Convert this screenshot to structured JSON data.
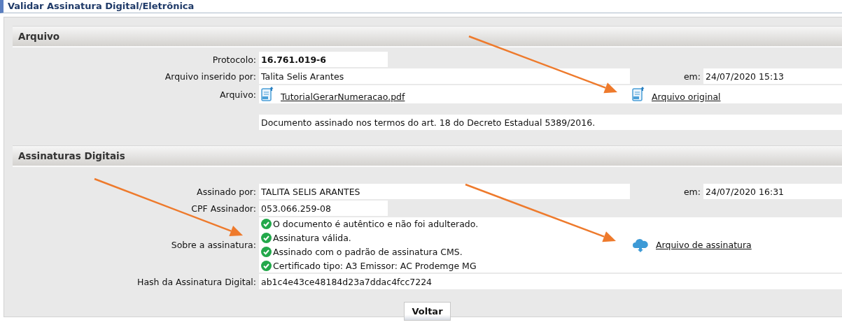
{
  "page_title": "Validar Assinatura Digital/Eletrônica",
  "sections": [
    {
      "title": "Arquivo",
      "rows": [
        {
          "kind": "protocol",
          "label": "Protocolo:",
          "value": "16.761.019-6"
        },
        {
          "kind": "dated",
          "label": "Arquivo inserido por:",
          "value": "Talita Selis Arantes",
          "date_label": "em:",
          "date": "24/07/2020 15:13"
        },
        {
          "kind": "file",
          "label": "Arquivo:",
          "value": "TutorialGerarNumeracao.pdf",
          "link": "Arquivo original"
        },
        {
          "kind": "note",
          "value": "Documento assinado nos termos do art. 18 do Decreto Estadual 5389/2016."
        }
      ]
    },
    {
      "title": "Assinaturas Digitais",
      "rows": [
        {
          "kind": "dated",
          "label": "Assinado por:",
          "value": "TALITA SELIS ARANTES",
          "date_label": "em:",
          "date": "24/07/2020 16:31"
        },
        {
          "kind": "short",
          "label": "CPF Assinador:",
          "value": "053.066.259-08"
        },
        {
          "kind": "checks",
          "label": "Sobre a assinatura:",
          "items": [
            "O documento é autêntico e não foi adulterado.",
            "Assinatura válida.",
            "Assinado com o padrão de assinatura CMS.",
            "Certificado tipo: A3 Emissor: AC Prodemge MG"
          ],
          "link": "Arquivo de assinatura"
        },
        {
          "kind": "text",
          "label": "Hash da Assinatura Digital:",
          "value": "ab1c4e43ce48184d23a7ddac4fcc7224"
        }
      ]
    }
  ],
  "button": "Voltar"
}
